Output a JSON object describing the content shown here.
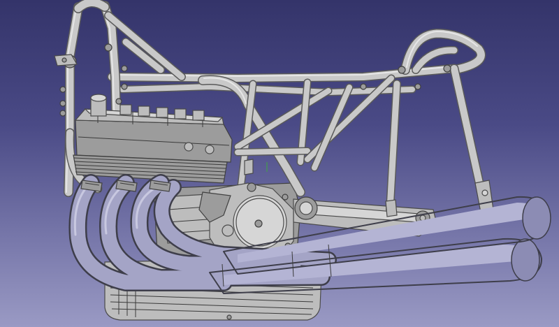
{
  "viewport": {
    "background_top": "#34346a",
    "background_bottom": "#9a9ac4",
    "model_color": "#c9c9c9",
    "exhaust_color": "#a4a4c6",
    "edge_color": "#3a3a3a"
  }
}
